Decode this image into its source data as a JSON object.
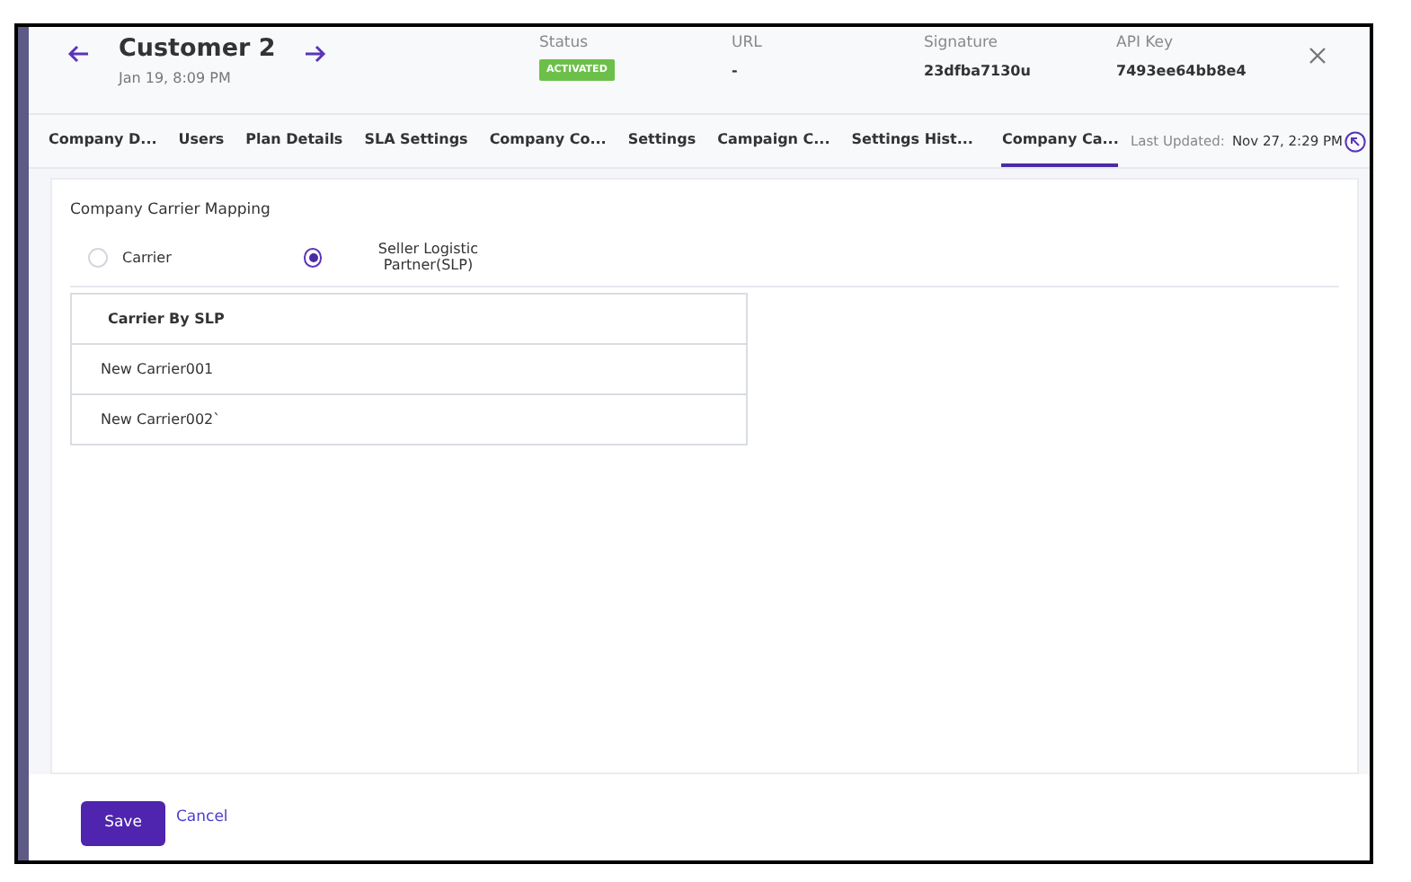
{
  "header": {
    "title": "Customer 2",
    "date": "Jan 19, 8:09 PM",
    "fields": [
      {
        "label": "Status",
        "value": "ACTIVATED",
        "kind": "badge"
      },
      {
        "label": "URL",
        "value": "-",
        "kind": "text"
      },
      {
        "label": "Signature",
        "value": "23dfba7130u",
        "kind": "text"
      },
      {
        "label": "API Key",
        "value": "7493ee64bb8e4",
        "kind": "text"
      }
    ]
  },
  "tabs": [
    {
      "label": "Company D...",
      "selected": false
    },
    {
      "label": "Users",
      "selected": false
    },
    {
      "label": "Plan Details",
      "selected": false
    },
    {
      "label": "SLA Settings",
      "selected": false
    },
    {
      "label": "Company Co...",
      "selected": false
    },
    {
      "label": "Settings",
      "selected": false
    },
    {
      "label": "Campaign C...",
      "selected": false
    },
    {
      "label": "Settings Hist...",
      "selected": false
    },
    {
      "label": "Company Ca...",
      "selected": true
    }
  ],
  "last_updated": {
    "label": "Last Updated:",
    "value": "Nov 27, 2:29 PM"
  },
  "section": {
    "title": "Company Carrier Mapping",
    "options": [
      {
        "label": "Carrier",
        "selected": false
      },
      {
        "label": "Seller Logistic Partner(SLP)",
        "selected": true
      }
    ],
    "table": {
      "columns": [
        "Carrier By SLP"
      ],
      "rows": [
        [
          "New Carrier001"
        ],
        [
          "New Carrier002`"
        ]
      ]
    }
  },
  "buttons": {
    "save": "Save",
    "cancel": "Cancel"
  }
}
